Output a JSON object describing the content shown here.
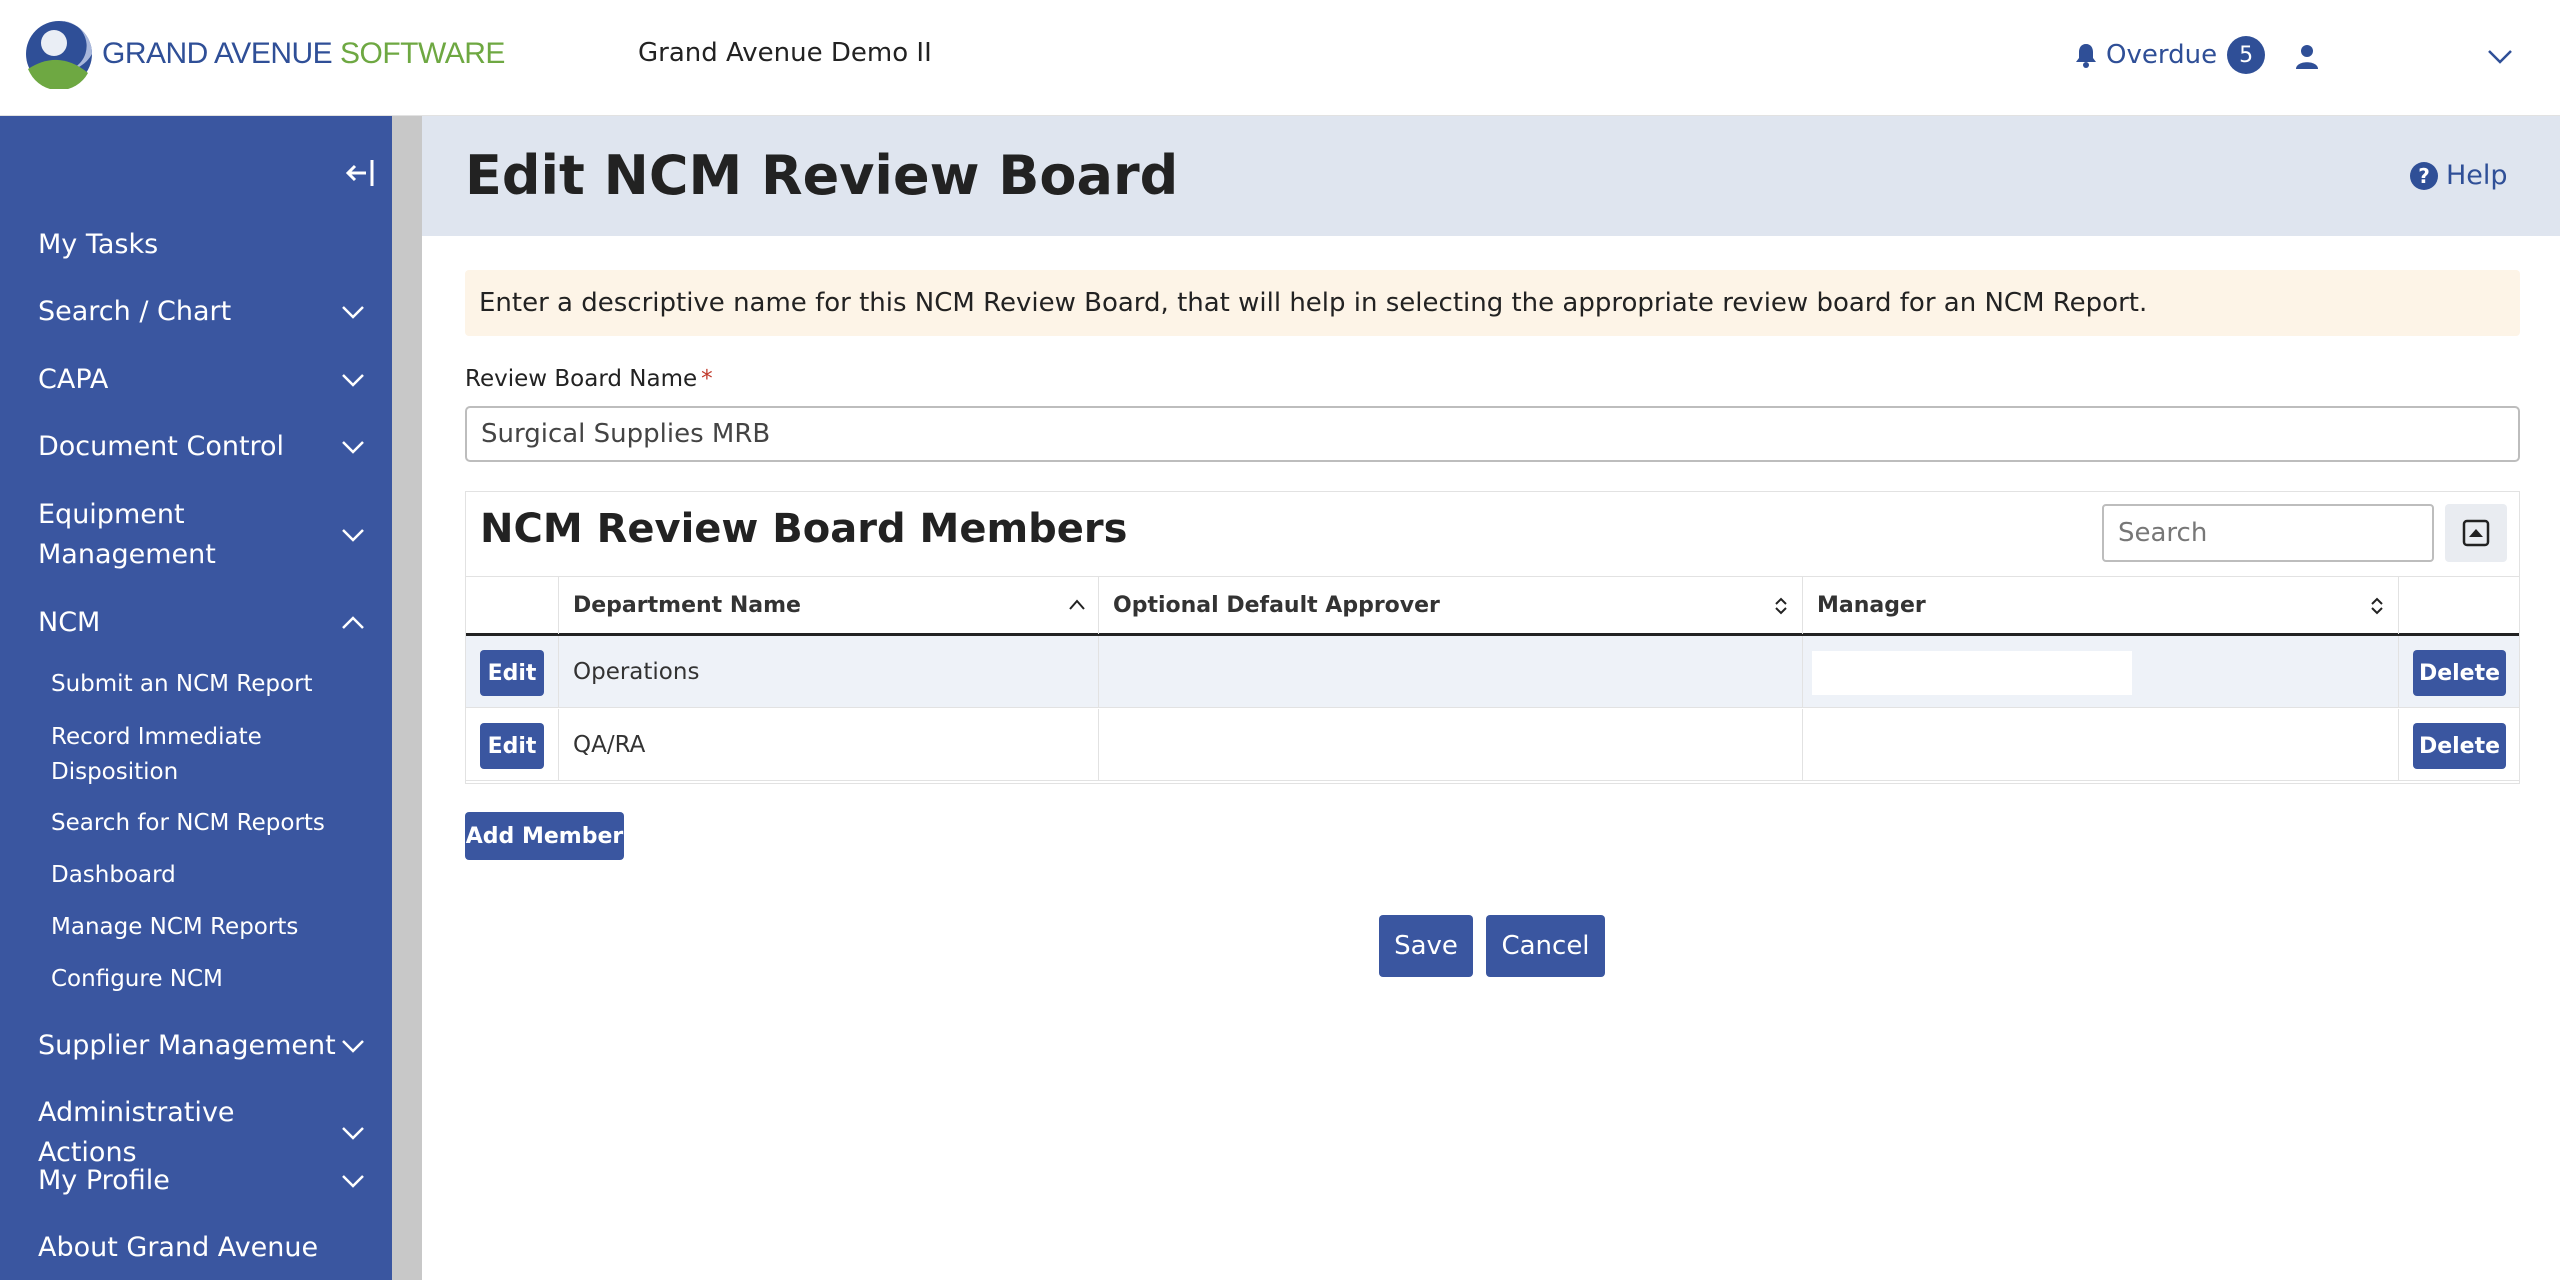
{
  "header": {
    "logo_text_1": "GRAND AVENUE",
    "logo_text_2": "SOFTWARE",
    "site_name": "Grand Avenue Demo II",
    "overdue_label": "Overdue",
    "overdue_count": "5",
    "icons": [
      "bell-icon",
      "user-icon",
      "chevron-down-icon"
    ]
  },
  "sidebar": {
    "items": [
      {
        "label": "My Tasks"
      },
      {
        "label": "Search / Chart"
      },
      {
        "label": "CAPA"
      },
      {
        "label": "Document Control"
      },
      {
        "label_line1": "Equipment",
        "label_line2": "Management"
      },
      {
        "label": "NCM"
      },
      {
        "label": "Supplier Management"
      },
      {
        "label": "Administrative Actions"
      },
      {
        "label": "My Profile"
      },
      {
        "label": "About Grand Avenue"
      }
    ],
    "ncm_subitems": [
      {
        "label": "Submit an NCM Report"
      },
      {
        "label_line1": "Record Immediate",
        "label_line2": "Disposition"
      },
      {
        "label": "Search for NCM Reports"
      },
      {
        "label": "Dashboard"
      },
      {
        "label": "Manage NCM Reports"
      },
      {
        "label": "Configure NCM"
      }
    ]
  },
  "page": {
    "title": "Edit NCM Review Board",
    "help_label": "Help",
    "info_text": "Enter a descriptive name for this NCM Review Board, that will help in selecting the appropriate review board for an NCM Report.",
    "field_label": "Review Board Name",
    "required_mark": "*",
    "field_value": "Surgical Supplies MRB"
  },
  "members": {
    "title": "NCM Review Board Members",
    "search_placeholder": "Search",
    "columns": [
      "Department Name",
      "Optional Default Approver",
      "Manager"
    ],
    "rows": [
      {
        "department": "Operations",
        "approver": "",
        "manager": "",
        "edit_label": "Edit",
        "delete_label": "Delete"
      },
      {
        "department": "QA/RA",
        "approver": "",
        "manager": "",
        "edit_label": "Edit",
        "delete_label": "Delete"
      }
    ],
    "add_label": "Add Member"
  },
  "actions": {
    "save_label": "Save",
    "cancel_label": "Cancel"
  },
  "colors": {
    "brand_blue": "#3a56a0",
    "link_blue": "#2f4f97",
    "brand_green": "#6ea842",
    "header_band": "#dfe5ef",
    "info_banner": "#fdf4e7"
  }
}
